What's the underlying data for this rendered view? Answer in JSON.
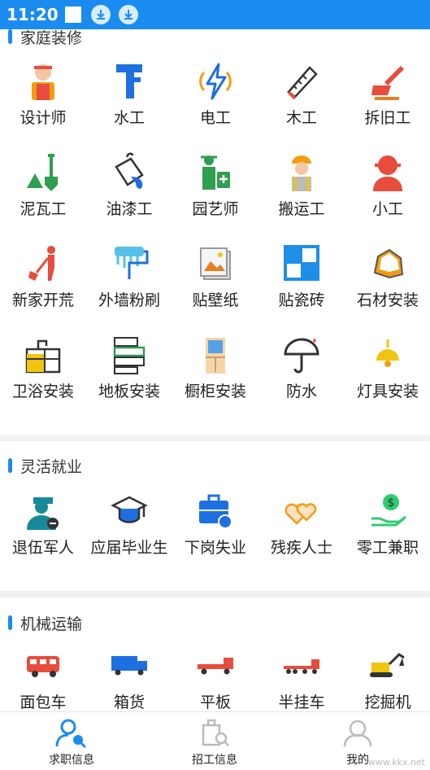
{
  "status": {
    "time": "11:20"
  },
  "sections": {
    "home": {
      "title": "家庭装修"
    },
    "flex": {
      "title": "灵活就业"
    },
    "machine": {
      "title": "机械运输"
    }
  },
  "home_items": [
    "设计师",
    "水工",
    "电工",
    "木工",
    "拆旧工",
    "泥瓦工",
    "油漆工",
    "园艺师",
    "搬运工",
    "小工",
    "新家开荒",
    "外墙粉刷",
    "贴壁纸",
    "贴瓷砖",
    "石材安装",
    "卫浴安装",
    "地板安装",
    "橱柜安装",
    "防水",
    "灯具安装"
  ],
  "flex_items": [
    "退伍军人",
    "应届毕业生",
    "下岗失业",
    "残疾人士",
    "零工兼职"
  ],
  "machine_items": [
    "面包车",
    "箱货",
    "平板",
    "半挂车",
    "挖掘机"
  ],
  "tabs": {
    "job_seek": "求职信息",
    "recruit": "招工信息",
    "mine": "我的"
  },
  "watermark": "www.kkx.net",
  "colors": {
    "accent": "#1a8cf0"
  }
}
